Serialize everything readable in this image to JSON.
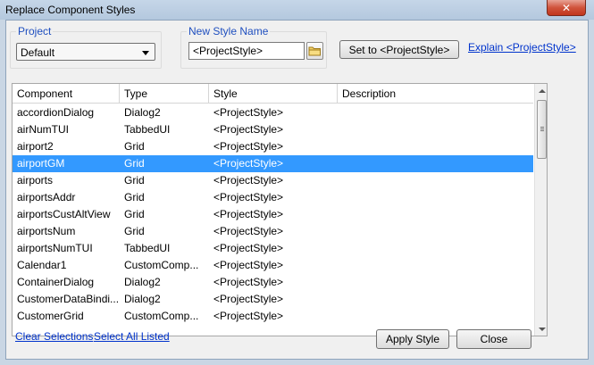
{
  "window": {
    "title": "Replace Component Styles",
    "close_glyph": "✕"
  },
  "project": {
    "legend": "Project",
    "selected": "Default"
  },
  "new_style": {
    "legend": "New Style Name",
    "value": "<ProjectStyle>",
    "browse_icon": "folder-icon"
  },
  "actions": {
    "set_to": "Set to <ProjectStyle>",
    "explain": "Explain <ProjectStyle>"
  },
  "table": {
    "columns": [
      "Component",
      "Type",
      "Style",
      "Description"
    ],
    "rows": [
      {
        "component": "accordionDialog",
        "type": "Dialog2",
        "style": "<ProjectStyle>",
        "description": ""
      },
      {
        "component": "airNumTUI",
        "type": "TabbedUI",
        "style": "<ProjectStyle>",
        "description": ""
      },
      {
        "component": "airport2",
        "type": "Grid",
        "style": "<ProjectStyle>",
        "description": ""
      },
      {
        "component": "airportGM",
        "type": "Grid",
        "style": "<ProjectStyle>",
        "description": "",
        "selected": true
      },
      {
        "component": "airports",
        "type": "Grid",
        "style": "<ProjectStyle>",
        "description": ""
      },
      {
        "component": "airportsAddr",
        "type": "Grid",
        "style": "<ProjectStyle>",
        "description": ""
      },
      {
        "component": "airportsCustAltView",
        "type": "Grid",
        "style": "<ProjectStyle>",
        "description": ""
      },
      {
        "component": "airportsNum",
        "type": "Grid",
        "style": "<ProjectStyle>",
        "description": ""
      },
      {
        "component": "airportsNumTUI",
        "type": "TabbedUI",
        "style": "<ProjectStyle>",
        "description": ""
      },
      {
        "component": "Calendar1",
        "type": "CustomComp...",
        "style": "<ProjectStyle>",
        "description": ""
      },
      {
        "component": "ContainerDialog",
        "type": "Dialog2",
        "style": "<ProjectStyle>",
        "description": ""
      },
      {
        "component": "CustomerDataBindi...",
        "type": "Dialog2",
        "style": "<ProjectStyle>",
        "description": ""
      },
      {
        "component": "CustomerGrid",
        "type": "CustomComp...",
        "style": "<ProjectStyle>",
        "description": ""
      }
    ]
  },
  "footer": {
    "clear_selections": "Clear Selections",
    "select_all": "Select All Listed",
    "apply": "Apply Style",
    "close": "Close"
  },
  "colors": {
    "selection": "#3399ff",
    "legend": "#1f4fbf",
    "link": "#0033cc"
  }
}
